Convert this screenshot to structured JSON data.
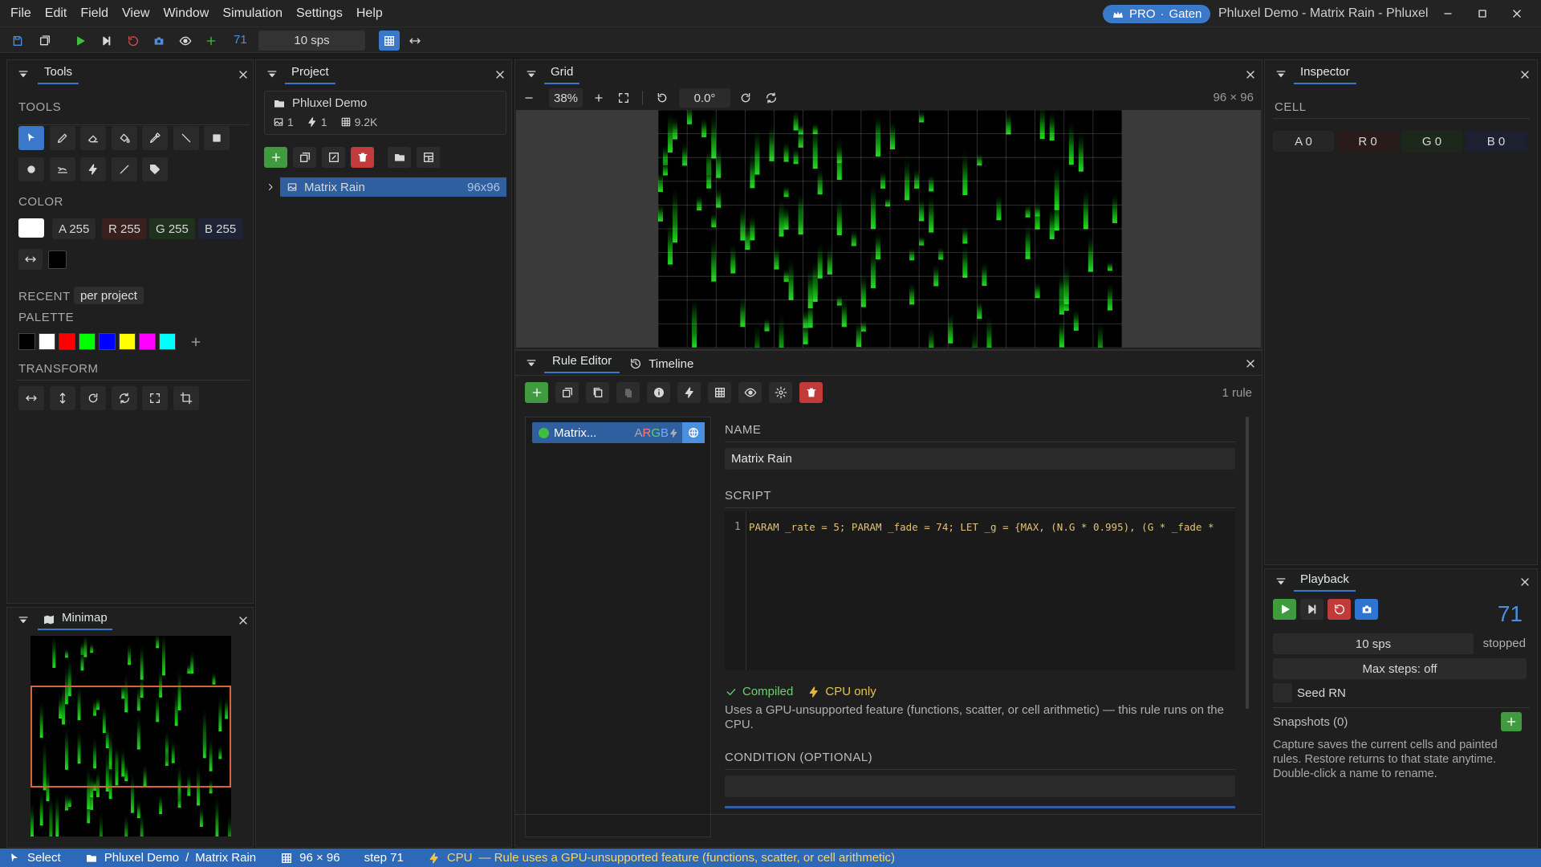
{
  "menu": [
    "File",
    "Edit",
    "Field",
    "View",
    "Window",
    "Simulation",
    "Settings",
    "Help"
  ],
  "badge": {
    "plan": "PRO",
    "sep": "·",
    "user": "Gaten"
  },
  "window_title": "Phluxel Demo - Matrix Rain - Phluxel",
  "toolbar": {
    "step": "71",
    "sps": "10 sps"
  },
  "tools_panel": {
    "title": "Tools",
    "tools_label": "TOOLS",
    "color_label": "COLOR",
    "argb": {
      "a": "A 255",
      "r": "R 255",
      "g": "G 255",
      "b": "B 255"
    },
    "recent_label": "RECENT",
    "recent_chip": "per project",
    "palette_label": "PALETTE",
    "palette": [
      "#000000",
      "#ffffff",
      "#ff0000",
      "#00ff00",
      "#0000ff",
      "#ffff00",
      "#ff00ff",
      "#00ffff"
    ],
    "transform_label": "TRANSFORM"
  },
  "minimap": {
    "title": "Minimap"
  },
  "project": {
    "title": "Project",
    "name": "Phluxel Demo",
    "stats": {
      "images": "1",
      "rules": "1",
      "cells": "9.2K"
    },
    "item": {
      "name": "Matrix Rain",
      "size": "96x96"
    }
  },
  "grid": {
    "title": "Grid",
    "zoom": "38%",
    "rotation": "0.0°",
    "dims": "96 × 96"
  },
  "rule_editor": {
    "tab1": "Rule Editor",
    "tab2": "Timeline",
    "count": "1 rule",
    "rule_item": {
      "name": "Matrix...",
      "a": "A",
      "r": "R",
      "g": "G",
      "b": "B"
    },
    "name_label": "NAME",
    "name_value": "Matrix Rain",
    "script_label": "SCRIPT",
    "line_no": "1",
    "script": "PARAM _rate = 5; PARAM _fade = 74; LET _g = {MAX, (N.G * 0.995), (G * _fade *",
    "compiled": "Compiled",
    "cpu_only": "CPU only",
    "note": "Uses a GPU-unsupported feature (functions, scatter, or cell arithmetic) — this rule runs on the CPU.",
    "condition_label": "CONDITION (OPTIONAL)"
  },
  "inspector": {
    "title": "Inspector",
    "cell_label": "CELL",
    "a": "A 0",
    "r": "R 0",
    "g": "G 0",
    "b": "B 0"
  },
  "playback": {
    "title": "Playback",
    "step": "71",
    "sps": "10 sps",
    "state": "stopped",
    "max_steps": "Max steps: off",
    "seed": "Seed RN",
    "snapshots": "Snapshots (0)",
    "help": "Capture saves the current cells and painted rules. Restore returns to that state anytime. Double-click a name to rename."
  },
  "status": {
    "tool": "Select",
    "project": "Phluxel Demo",
    "sep": "/",
    "image": "Matrix Rain",
    "dims": "96 × 96",
    "step": "step 71",
    "backend": "CPU",
    "message": "— Rule uses a GPU-unsupported feature (functions, scatter, or cell arithmetic)"
  },
  "colors": {
    "accent": "#3a78c9",
    "green": "#3f9b3d",
    "red": "#c23b3b",
    "matrix": "#22dd22"
  }
}
